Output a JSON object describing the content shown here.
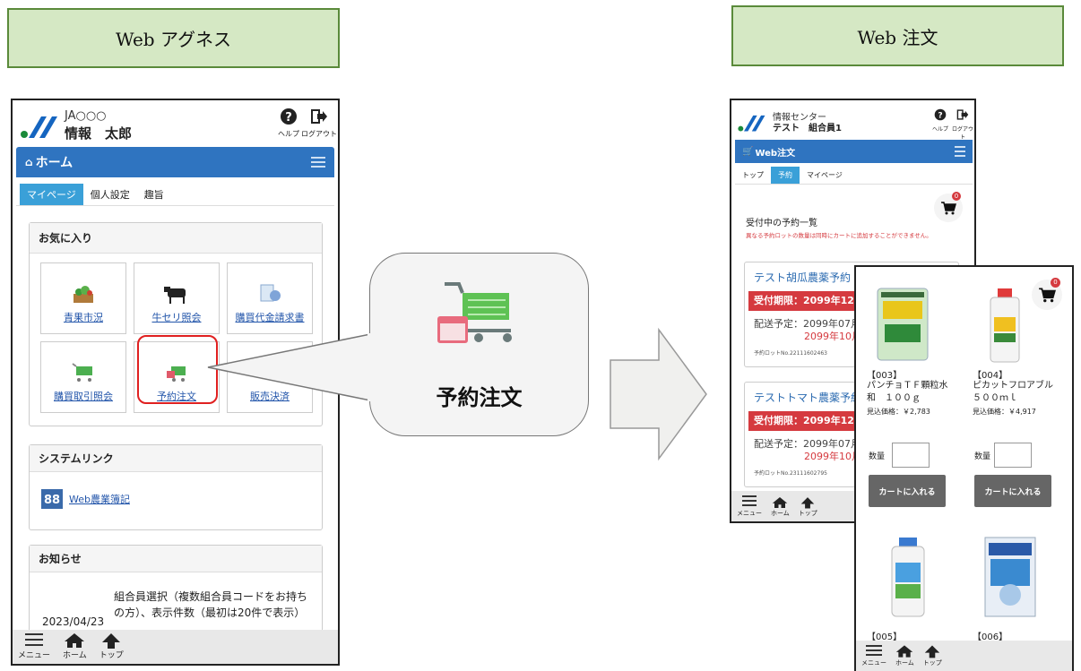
{
  "labels": {
    "left": "Web アグネス",
    "right": "Web 注文"
  },
  "callout": {
    "text": "予約注文"
  },
  "left_phone": {
    "org": "JA○○○",
    "user": "情報　太郎",
    "help": "ヘルプ",
    "logout": "ログアウト",
    "nav_title": "ホーム",
    "tabs": [
      "マイページ",
      "個人設定",
      "趣旨"
    ],
    "favorites": {
      "title": "お気に入り",
      "items": [
        "青果市況",
        "牛セリ照会",
        "購買代金請求書",
        "購買取引照会",
        "予約注文",
        "販売決済"
      ]
    },
    "system_links": {
      "title": "システムリンク",
      "link": "Web農業簿記"
    },
    "notices": {
      "title": "お知らせ",
      "date": "2023/04/23",
      "text": "組合員選択（複数組合員コードをお持ちの方）、表示件数（最初は20件で表示）"
    },
    "bottom": [
      "メニュー",
      "ホーム",
      "トップ"
    ]
  },
  "right_phone": {
    "org": "情報センター",
    "user": "テスト　組合員1",
    "help": "ヘルプ",
    "logout": "ログアウト",
    "nav_title": "Web注文",
    "tabs": [
      "トップ",
      "予約",
      "マイページ"
    ],
    "list_title": "受付中の予約一覧",
    "warning": "異なる予約ロットの数量は同時にカートに追加することができません。",
    "cart_count": "0",
    "reservations": [
      {
        "name": "テスト胡瓜農薬予約",
        "deadline": "受付期限：2099年12",
        "ship1": "配送予定：2099年07月",
        "ship2": "2099年10月",
        "lot": "予約ロットNo.22111602463"
      },
      {
        "name": "テストトマト農薬予約",
        "deadline": "受付期限：2099年12",
        "ship1": "配送予定：2099年07月",
        "ship2": "2099年10月",
        "lot": "予約ロットNo.23111602795"
      }
    ],
    "bottom": [
      "メニュー",
      "ホーム",
      "トップ"
    ]
  },
  "product_panel": {
    "cart_count": "0",
    "products": [
      {
        "code": "【003】",
        "name": "パンチョＴＦ顆粒水和　１００ｇ",
        "price": "見込価格：￥2,783",
        "qty_label": "数量",
        "button": "カートに入れる"
      },
      {
        "code": "【004】",
        "name": "ピカットフロアブル　５００ｍｌ",
        "price": "見込価格：￥4,917",
        "qty_label": "数量",
        "button": "カートに入れる"
      },
      {
        "code": "【005】"
      },
      {
        "code": "【006】"
      }
    ],
    "bottom": [
      "メニュー",
      "ホーム",
      "トップ"
    ]
  },
  "colors": {
    "nav_blue": "#2f74c0",
    "tab_active": "#3aa0d8",
    "deadline_red": "#d53a3f",
    "label_green_bg": "#d5e8c4",
    "label_green_border": "#5a8a3a"
  }
}
